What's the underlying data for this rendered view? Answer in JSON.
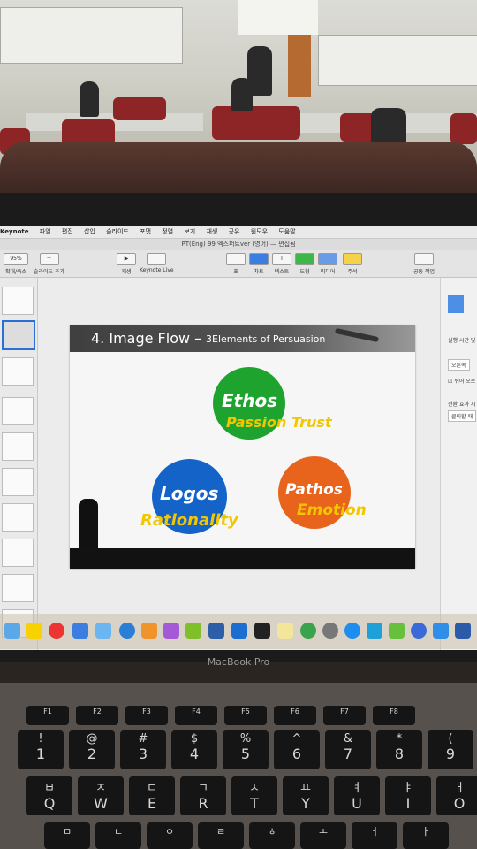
{
  "menubar": {
    "items": [
      "Keynote",
      "파일",
      "편집",
      "삽입",
      "슬라이드",
      "포맷",
      "정렬",
      "보기",
      "재생",
      "공유",
      "윈도우",
      "도움말"
    ]
  },
  "window": {
    "title": "PT(Eng) 99 엑스퍼트ver (영어) — 편집됨"
  },
  "toolbar": {
    "zoom": "95%",
    "zoom_label": "확대/축소",
    "add_slide_label": "슬라이드 추가",
    "play_label": "재생",
    "keynote_live_label": "Keynote Live",
    "table_label": "표",
    "chart_label": "차트",
    "text_label": "텍스트",
    "shape_label": "도형",
    "media_label": "미디어",
    "comment_label": "주석",
    "collab_label": "공동 작업"
  },
  "inspector": {
    "duration": "실행 시간 및",
    "direction": "오른쪽",
    "checkbox": "뒤어 오르",
    "transition": "전환 효과 시",
    "trigger": "클릭할 때"
  },
  "slide": {
    "title": "4. Image Flow –",
    "subtitle": "3Elements of Persuasion",
    "ethos": "Ethos",
    "ethos_sub": "Passion Trust",
    "logos": "Logos",
    "logos_sub": "Rationality",
    "pathos": "Pathos",
    "pathos_sub": "Emotion"
  },
  "laptop": {
    "brand": "MacBook Pro"
  },
  "keys": {
    "fn": [
      "F1",
      "F2",
      "F3",
      "F4",
      "F5",
      "F6",
      "F7",
      "F8"
    ],
    "num": [
      [
        "!",
        "1"
      ],
      [
        "@",
        "2"
      ],
      [
        "#",
        "3"
      ],
      [
        "$",
        "4"
      ],
      [
        "%",
        "5"
      ],
      [
        "^",
        "6"
      ],
      [
        "&",
        "7"
      ],
      [
        "*",
        "8"
      ],
      [
        "(",
        "9"
      ]
    ],
    "q": [
      [
        "ㅂ",
        "Q"
      ],
      [
        "ㅈ",
        "W"
      ],
      [
        "ㄷ",
        "E"
      ],
      [
        "ㄱ",
        "R"
      ],
      [
        "ㅅ",
        "T"
      ],
      [
        "ㅛ",
        "Y"
      ],
      [
        "ㅕ",
        "U"
      ],
      [
        "ㅑ",
        "I"
      ],
      [
        "ㅐ",
        "O"
      ]
    ],
    "a": [
      "ㅁ",
      "ㄴ",
      "ㅇ",
      "ㄹ",
      "ㅎ",
      "ㅗ",
      "ㅓ",
      "ㅏ"
    ]
  },
  "colors": {
    "ethos": "#1ea32e",
    "logos": "#1463c8",
    "pathos": "#e8641c",
    "accent_yellow": "#f2c700"
  }
}
